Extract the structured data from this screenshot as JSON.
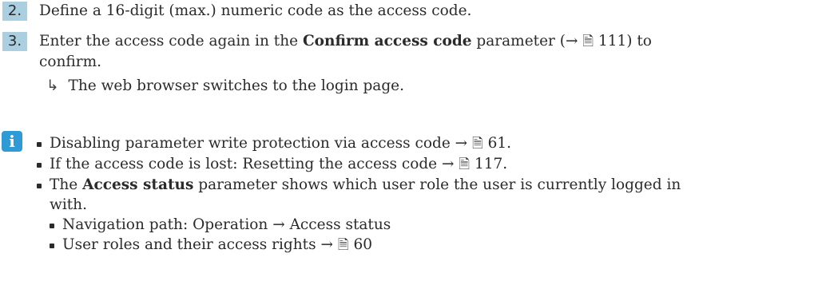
{
  "steps": [
    {
      "number": "2.",
      "text": "Define a 16-digit (max.) numeric code as the access code."
    },
    {
      "number": "3.",
      "pre": "Enter the access code again in the ",
      "bold": "Confirm access code",
      "post": " parameter (→ ",
      "page": "111",
      "end": ") to",
      "line2": "confirm."
    }
  ],
  "result": {
    "arrow": "↳",
    "text": "The web browser switches to the login page."
  },
  "info_icon": "info-icon",
  "notes": {
    "item1": {
      "text": "Disabling parameter write protection via access code → ",
      "page": "61",
      "end": "."
    },
    "item2": {
      "text": "If the access code is lost: Resetting the access code → ",
      "page": "117",
      "end": "."
    },
    "item3": {
      "pre": "The ",
      "bold": "Access status",
      "post": " parameter shows which user role the user is currently logged in",
      "line2": "with."
    },
    "sub1": {
      "text": "Navigation path: Operation → Access status"
    },
    "sub2": {
      "text": "User roles and their access rights → ",
      "page": "60"
    }
  },
  "book_symbol": "🗎"
}
